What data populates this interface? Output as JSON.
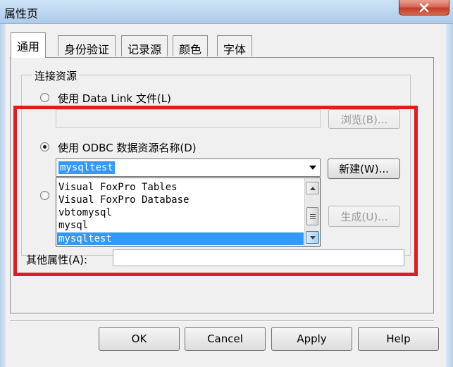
{
  "window": {
    "title": "属性页"
  },
  "tabs": [
    {
      "label": "通用",
      "active": true
    },
    {
      "label": "身份验证",
      "active": false
    },
    {
      "label": "记录源",
      "active": false
    },
    {
      "label": "颜色",
      "active": false
    },
    {
      "label": "字体",
      "active": false
    }
  ],
  "connection_group": {
    "title": "连接资源",
    "option_datalink": {
      "label": "使用 Data Link 文件(L)",
      "checked": false,
      "browse_label": "浏览(B)...",
      "browse_enabled": false,
      "path_value": ""
    },
    "option_odbc": {
      "label": "使用 ODBC 数据资源名称(D)",
      "checked": true,
      "dsn_value": "mysqltest",
      "new_label": "新建(W)..."
    },
    "option_connstring": {
      "checked": false,
      "build_label": "生成(U)...",
      "build_enabled": false
    }
  },
  "dsn_dropdown": {
    "options": [
      "Visual FoxPro Tables",
      "Visual FoxPro Database",
      "vbtomysql",
      "mysql",
      "mysqltest"
    ],
    "selected_index": 4
  },
  "other_properties": {
    "label": "其他属性(A):",
    "value": ""
  },
  "footer": {
    "ok": "OK",
    "cancel": "Cancel",
    "apply": "Apply",
    "help": "Help"
  },
  "colors": {
    "highlight_border": "#e01b24",
    "selection": "#3399ff",
    "title_bar": "#bcd5ef",
    "close_button": "#c23c26"
  },
  "icons": {
    "close": "close-icon",
    "combo_arrow": "chevron-down-icon",
    "scroll_up": "scroll-up-arrow-icon",
    "scroll_down": "scroll-down-arrow-icon",
    "scroll_grip": "scroll-grip-icon"
  }
}
